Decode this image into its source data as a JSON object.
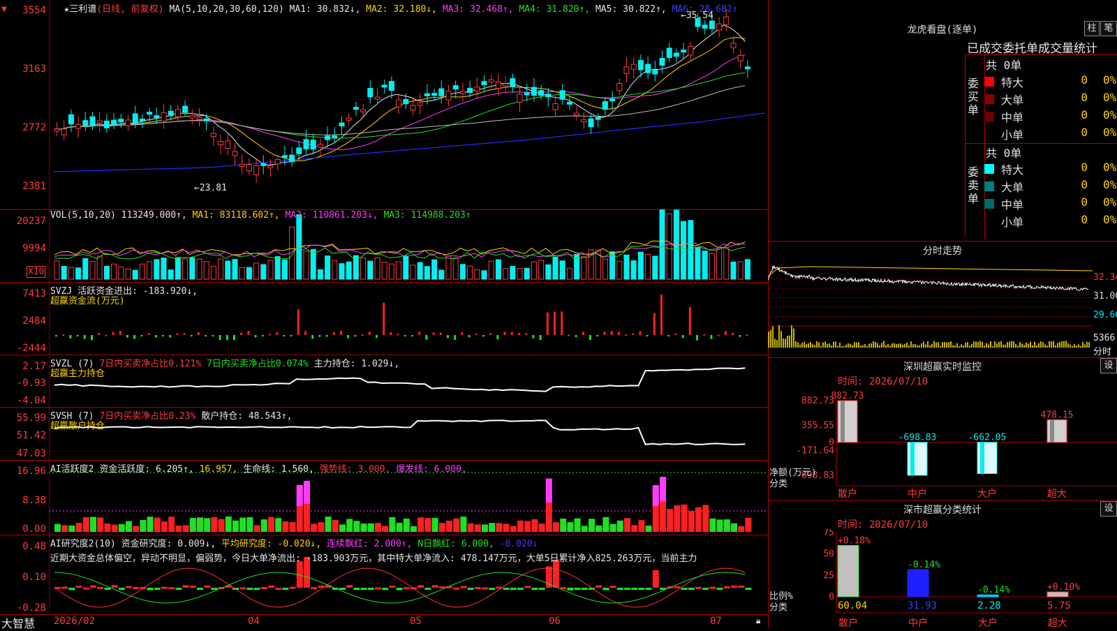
{
  "stock": {
    "title": "三利谱",
    "title_prefix": "★",
    "period": "(日线, 前复权)"
  },
  "main_legend": {
    "ma_spec": "MA(5,10,20,30,60,120)",
    "ma1": "MA1: 30.832↓,",
    "ma2": "MA2: 32.180↓,",
    "ma3": "MA3: 32.468↑,",
    "ma4": "MA4: 31.820↑,",
    "ma5": "MA5: 30.822↑,",
    "ma6": "MA6: 28.682↑"
  },
  "price_axis": {
    "labels": [
      "3554",
      "3163",
      "2772",
      "2381"
    ],
    "high_mark": "35.54",
    "low_mark": "23.81"
  },
  "vol_panel": {
    "legend": "VOL(5,10,20)",
    "vol": "113249.000↑,",
    "ma1": "MA1: 83118.602↑,",
    "ma2": "MA2: 110861.203↓,",
    "ma3": "MA3: 114988.203↑",
    "axis": [
      "20237",
      "9994"
    ],
    "unit": "X10"
  },
  "svzj_panel": {
    "legend": "SVZJ  活跃资金进出: -183.920↓,",
    "subtitle": "超赢资金流(万元)",
    "axis": [
      "7413",
      "2484",
      "-2444"
    ]
  },
  "svzl_panel": {
    "legend_a": "SVZL (7)",
    "legend_b": "7日内买卖净占比0.121%",
    "legend_c": "7日内买卖净占比0.074%",
    "legend_d": "主力持仓: 1.029↓,",
    "subtitle": "超赢主力持仓",
    "axis": [
      "2.17",
      "-0.93",
      "-4.04"
    ]
  },
  "svsh_panel": {
    "legend_a": "SVSH (7)",
    "legend_b": "7日内买卖净占比0.23%",
    "legend_c": "散户持仓: 48.543↑,",
    "subtitle": "超赢散户持仓",
    "axis": [
      "55.99",
      "51.42",
      "47.03"
    ]
  },
  "ai_active_panel": {
    "legend_a": "AI活跃度2",
    "legend_b": "资金活跃度: 6.205↑,",
    "legend_c": "16.957,",
    "legend_d": "生命线: 1.560,",
    "legend_e": "强势线: 3.000,",
    "legend_f": "爆发线: 6.000,",
    "axis": [
      "16.96",
      "8.38",
      "0.00"
    ]
  },
  "ai_research_panel": {
    "legend_a": "AI研究度2(10)",
    "legend_b": "资金研究度: 0.009↓,",
    "legend_c": "平均研究度: -0.020↓,",
    "legend_d": "连续飘红: 2.000↑,",
    "legend_e": "N日飘红: 6.000,",
    "legend_f": "-0.020↓",
    "commentary": "近期大资金总体偏空，异动不明显，偏弱势，今日大单净流出: -183.903万元，其中特大单净流入: 478.147万元，大单5日累计净入825.263万元，当前主力",
    "axis": [
      "0.48",
      "0.10",
      "-0.28"
    ]
  },
  "bottom_bar": {
    "app": "大智慧",
    "dates": [
      "2026/02",
      "04",
      "05",
      "06",
      "07"
    ]
  },
  "dragon_tiger": {
    "title": "龙虎看盘(逐单)",
    "btn_bar": "柱",
    "btn_pen": "笔",
    "header": "已成交委托单成交量统计",
    "buy": {
      "side": "委买单",
      "total": "共 0单",
      "rows": [
        {
          "label": "特大",
          "n": "0",
          "p": "0%"
        },
        {
          "label": "大单",
          "n": "0",
          "p": "0%"
        },
        {
          "label": "中单",
          "n": "0",
          "p": "0%"
        },
        {
          "label": "小单",
          "n": "0",
          "p": "0%"
        }
      ]
    },
    "sell": {
      "side": "委卖单",
      "total": "共 0单",
      "rows": [
        {
          "label": "特大",
          "n": "0",
          "p": "0%"
        },
        {
          "label": "大单",
          "n": "0",
          "p": "0%"
        },
        {
          "label": "中单",
          "n": "0",
          "p": "0%"
        },
        {
          "label": "小单",
          "n": "0",
          "p": "0%"
        }
      ]
    },
    "colors": {
      "buy_xl": "#ff0000",
      "buy_l": "#8b0000",
      "buy_m": "#6b0000",
      "sell_xl": "#00ffff",
      "sell_l": "#008080",
      "sell_m": "#006b6b"
    }
  },
  "intraday": {
    "title": "分时走势",
    "axis": [
      "32.34",
      "31.00",
      "29.66"
    ],
    "vol_label": "5366",
    "vol_unit": "分时"
  },
  "sz_monitor": {
    "title": "深圳超赢实时监控",
    "settings": "设",
    "time": "时间: 2026/07/10",
    "ylabel": "净额(万元)",
    "xlabel": "分类",
    "axis": [
      "882.73",
      "355.55",
      "0",
      "-171.64",
      "-698.83"
    ],
    "chart_data": {
      "type": "bar",
      "categories": [
        "散户",
        "中户",
        "大户",
        "超大"
      ],
      "values": [
        882.73,
        -698.83,
        -662.05,
        478.15
      ],
      "labels": [
        "882.73",
        "-698.83",
        "-662.05",
        "478.15"
      ],
      "ylim": [
        -698.83,
        882.73
      ],
      "ylabel": "净额(万元)",
      "xlabel": "分类"
    }
  },
  "sz_classify": {
    "title": "深市超赢分类统计",
    "settings": "设",
    "time": "时间: 2026/07/10",
    "ylabel": "比例%",
    "xlabel": "分类",
    "axis": [
      "75",
      "50",
      "25",
      "0"
    ],
    "chart_data": {
      "type": "bar",
      "categories": [
        "散户",
        "中户",
        "大户",
        "超大"
      ],
      "values": [
        60.04,
        31.93,
        2.28,
        5.75
      ],
      "changes": [
        "+0.18%",
        "-0.14%",
        "-0.14%",
        "+0.10%"
      ],
      "labels": [
        "60.04",
        "31.93",
        "2.28",
        "5.75"
      ],
      "ylim": [
        0,
        75
      ],
      "ylabel": "比例%",
      "xlabel": "分类"
    }
  }
}
